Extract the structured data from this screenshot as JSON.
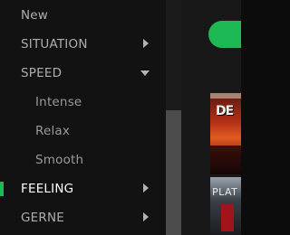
{
  "sidebar": {
    "items": [
      {
        "label": "New",
        "type": "top"
      },
      {
        "label": "SITUATION",
        "type": "top",
        "arrow": "right"
      },
      {
        "label": "SPEED",
        "type": "top",
        "arrow": "down"
      },
      {
        "label": "Intense",
        "type": "sub"
      },
      {
        "label": "Relax",
        "type": "sub"
      },
      {
        "label": "Smooth",
        "type": "sub"
      },
      {
        "label": "FEELING",
        "type": "top",
        "arrow": "right",
        "active": true
      },
      {
        "label": "GERNE",
        "type": "top",
        "arrow": "right"
      }
    ]
  },
  "main": {
    "covers": [
      {
        "text": "DE"
      },
      {
        "text": "PLAT"
      }
    ]
  },
  "colors": {
    "accent": "#1db954",
    "sidebar_bg": "#121212",
    "text": "#aeaeae",
    "active_text": "#ffffff"
  }
}
